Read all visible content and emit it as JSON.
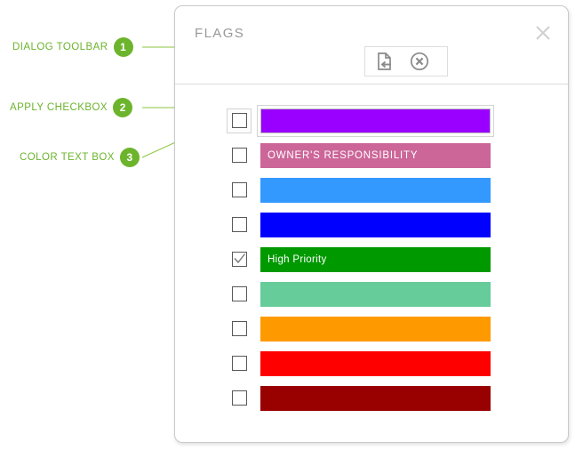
{
  "annotations": [
    {
      "number": "1",
      "label": "DIALOG TOOLBAR"
    },
    {
      "number": "2",
      "label": "APPLY CHECKBOX"
    },
    {
      "number": "3",
      "label": "COLOR TEXT BOX"
    }
  ],
  "annotation_color": "#6cb42c",
  "dialog": {
    "title": "FLAGS",
    "close_label": "✕",
    "toolbar": {
      "buttons": [
        {
          "name": "apply-flag-icon",
          "tooltip": "Apply"
        },
        {
          "name": "clear-flag-icon",
          "tooltip": "Clear"
        }
      ]
    },
    "flags": [
      {
        "label": "",
        "color": "#9900ff",
        "checked": false,
        "focused": true
      },
      {
        "label": "OWNER'S RESPONSIBILITY",
        "color": "#cc6699",
        "checked": false,
        "focused": false
      },
      {
        "label": "",
        "color": "#3399ff",
        "checked": false,
        "focused": false
      },
      {
        "label": "",
        "color": "#0000ff",
        "checked": false,
        "focused": false
      },
      {
        "label": "High Priority",
        "color": "#009900",
        "checked": true,
        "focused": false
      },
      {
        "label": "",
        "color": "#66cc99",
        "checked": false,
        "focused": false
      },
      {
        "label": "",
        "color": "#ff9900",
        "checked": false,
        "focused": false
      },
      {
        "label": "",
        "color": "#ff0000",
        "checked": false,
        "focused": false
      },
      {
        "label": "",
        "color": "#990000",
        "checked": false,
        "focused": false
      }
    ]
  }
}
